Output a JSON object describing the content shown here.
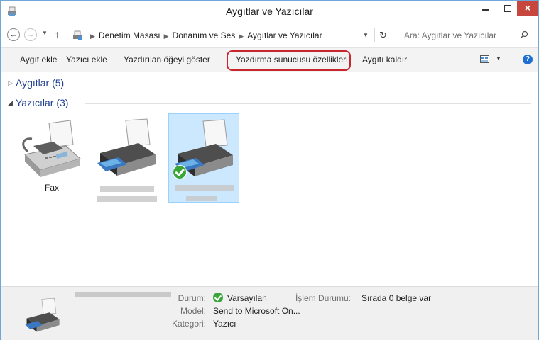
{
  "window": {
    "title": "Aygıtlar ve Yazıcılar",
    "close_glyph": "×"
  },
  "navigation": {
    "back_glyph": "←",
    "forward_glyph": "→",
    "up_glyph": "↑",
    "breadcrumbs": [
      "Denetim Masası",
      "Donanım ve Ses",
      "Aygıtlar ve Yazıcılar"
    ],
    "search_placeholder": "Ara: Aygıtlar ve Yazıcılar"
  },
  "toolbar": {
    "add_device": "Aygıt ekle",
    "add_printer": "Yazıcı ekle",
    "see_whats_printing": "Yazdırılan öğeyi göster",
    "print_server_properties": "Yazdırma sunucusu özellikleri",
    "remove_device": "Aygıtı kaldır",
    "help_glyph": "?",
    "highlighted_item": "Yazdırma sunucusu özellikleri",
    "highlight_color": "#c7262e"
  },
  "groups": [
    {
      "label": "Aygıtlar (5)",
      "expanded": false
    },
    {
      "label": "Yazıcılar (3)",
      "expanded": true
    }
  ],
  "printers": [
    {
      "name": "Fax",
      "icon": "fax-icon",
      "is_default": false,
      "selected": false
    },
    {
      "name": "",
      "icon": "printer-icon",
      "is_default": false,
      "selected": false
    },
    {
      "name": "",
      "icon": "printer-icon",
      "is_default": true,
      "selected": true
    }
  ],
  "details": {
    "status_key": "Durum:",
    "status_value": "Varsayılan",
    "model_key": "Model:",
    "model_value": "Send to Microsoft On...",
    "category_key": "Kategori:",
    "category_value": "Yazıcı",
    "job_status_key": "İşlem Durumu:",
    "job_status_value": "Sırada 0 belge var"
  },
  "colors": {
    "selection_bg": "#cce8ff",
    "group_label": "#1e3f8f",
    "close_button": "#c7463d",
    "default_check": "#3aa63a"
  }
}
